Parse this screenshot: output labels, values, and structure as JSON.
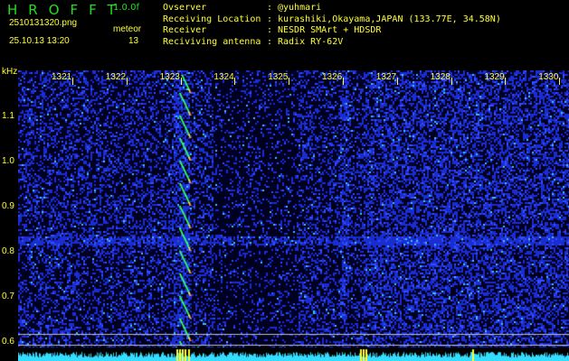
{
  "app": {
    "title": "HROFFT",
    "version": "1.0.0f"
  },
  "file": {
    "name": "2510131320.png",
    "datetime": "25.10.13 13:20"
  },
  "meteor": {
    "label": "meteor",
    "count": "13"
  },
  "info": [
    {
      "key": "Ovserver",
      "value": "@yuhmari"
    },
    {
      "key": "Receiving Location",
      "value": "kurashiki,Okayama,JAPAN (133.77E, 34.58N)"
    },
    {
      "key": "Receiver",
      "value": "NESDR SMArt + HDSDR"
    },
    {
      "key": "Reciviving antenna",
      "value": "Radix RY-62V"
    }
  ],
  "axis": {
    "y_unit": "kHz",
    "y_ticks": [
      "1.1",
      "1.0",
      "0.9",
      "0.8",
      "0.7",
      "0.6"
    ],
    "x_ticks": [
      "1321",
      "1322",
      "1323",
      "1324",
      "1325",
      "1326",
      "1327",
      "1328",
      "1329",
      "1330"
    ]
  },
  "colors": {
    "text": "#ffff33",
    "title": "#22dd22",
    "background": "#000000",
    "noise": "#1a2dd0",
    "spectrum": "#33ddff"
  }
}
